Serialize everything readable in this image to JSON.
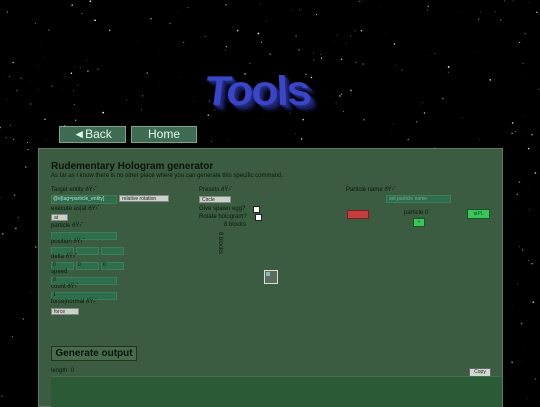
{
  "nav": {
    "back_label": "◄Back",
    "home_label": "Home",
    "logo_text": "Tools"
  },
  "panel": {
    "title": "Rudementary Hologram generator",
    "subtitle": "As far as I know there is no other place where you can generate this specific command.",
    "target_entity_label": "Target entity ðŸ›ˆ",
    "target_entity_value": "@e[tag=particle_entity]",
    "relative_rotation": "relative rotation",
    "execute_asat_label": "execute as|at ðŸ›ˆ",
    "execute_value": "at",
    "particle_label": "particle ðŸ›ˆ",
    "position_label": "position ðŸ›ˆ",
    "delta_label": "delta ðŸ›ˆ",
    "delta_values": [
      "0",
      "0",
      "0"
    ],
    "speed_label": "speed",
    "speed_value": "0",
    "count_label": "count ðŸ›ˆ",
    "count_value": "1",
    "force_label": "force|normal ðŸ›ˆ",
    "force_value": "force",
    "presets_label": "Presets ðŸ›ˆ",
    "presets_value": "Circle",
    "spawn_egg_label": "Give spawn egg?",
    "rotate_label": "Rotate hologram?",
    "blocks_h": "8 blocks",
    "blocks_v": "8 blocks",
    "particle_name_label": "Particle name ðŸ›ˆ",
    "particle_name_placeholder": "set particle name",
    "particle_counter": "particle 0",
    "counter_btn": "+",
    "green_btn": "⊕PL",
    "generate_label": "Generate output",
    "length_label": "length: 0",
    "copy_label": "Copy"
  },
  "colors": {
    "panel": "#3b5c41",
    "field": "#2f6e4c",
    "red_btn": "#c43c3c",
    "green_btn": "#3ec45a"
  }
}
